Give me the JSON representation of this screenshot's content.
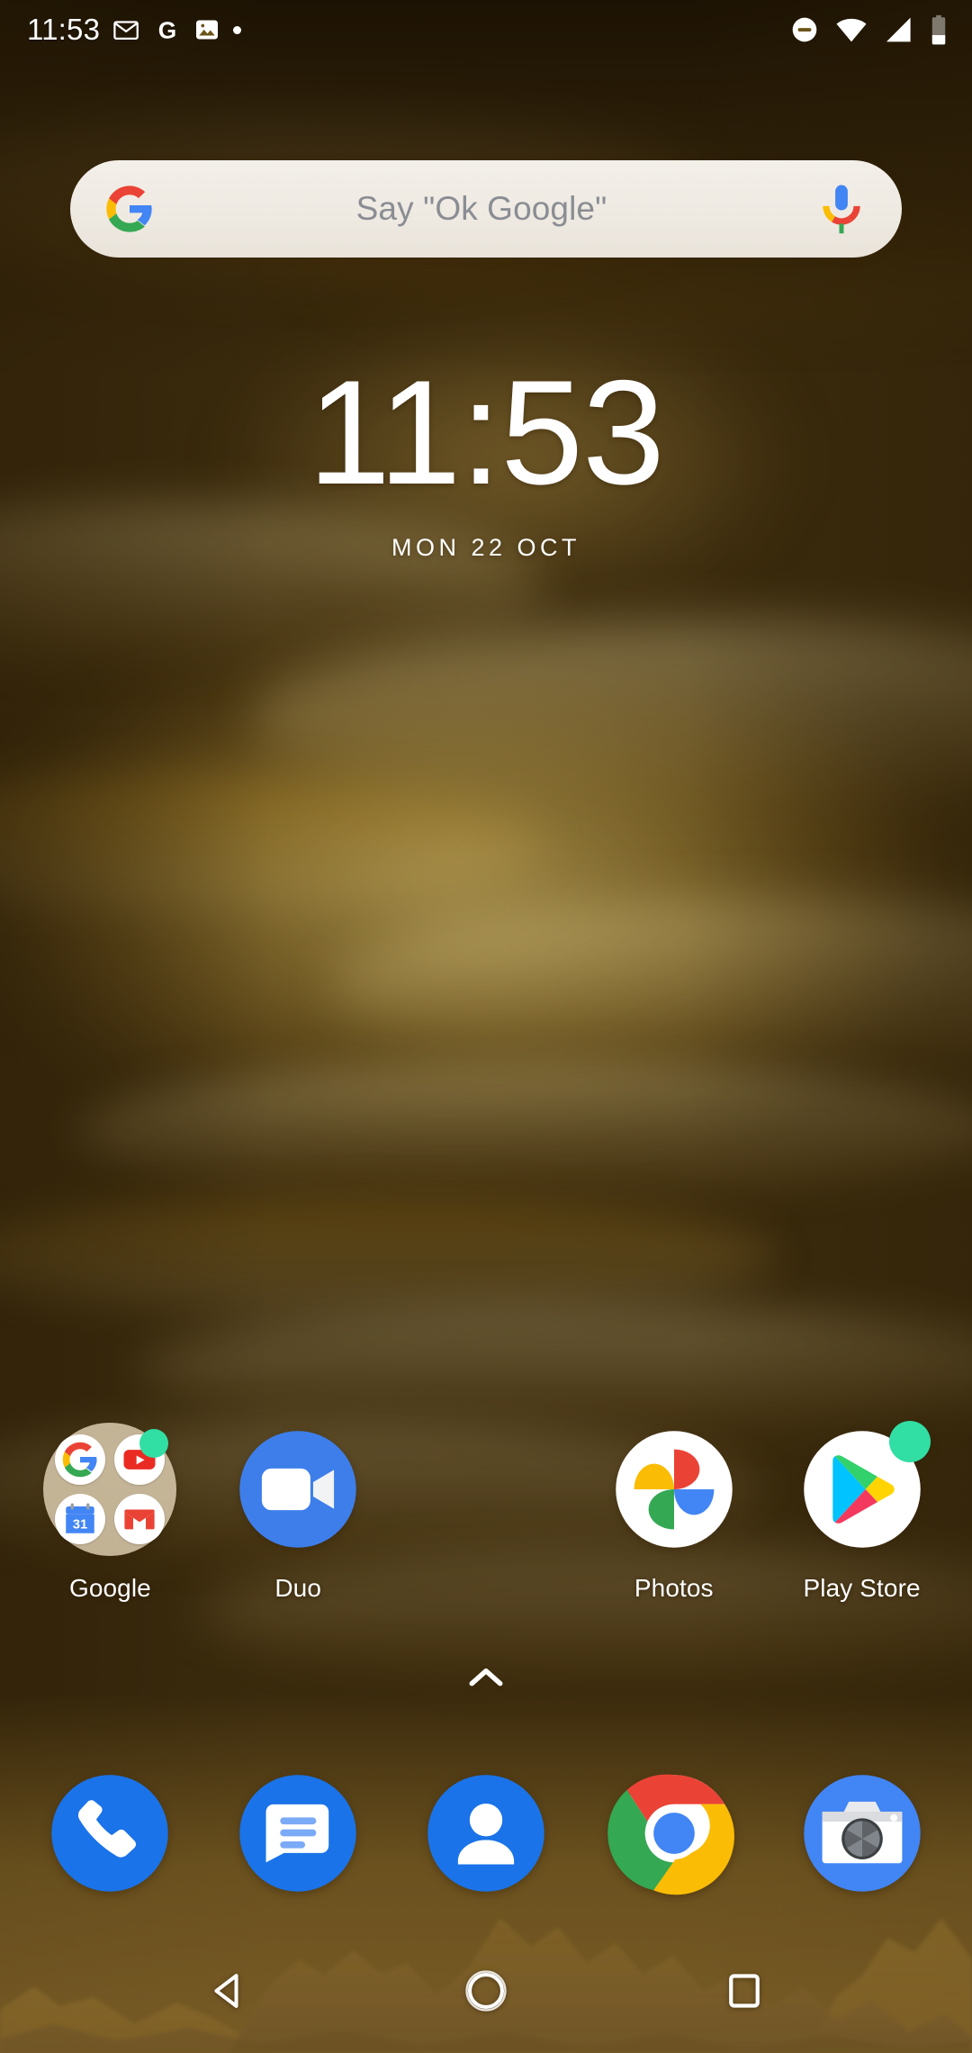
{
  "status_bar": {
    "time": "11:53",
    "left_icons": [
      {
        "name": "gmail-icon",
        "label": "Gmail"
      },
      {
        "name": "google-icon",
        "label": "G"
      },
      {
        "name": "photos-notification-icon",
        "label": "Photos"
      },
      {
        "name": "more-notifications-dot",
        "label": "•"
      }
    ],
    "right_icons": [
      {
        "name": "do-not-disturb-icon",
        "label": "Do Not Disturb"
      },
      {
        "name": "wifi-icon",
        "label": "Wi-Fi"
      },
      {
        "name": "cellular-signal-icon",
        "label": "Signal"
      },
      {
        "name": "battery-icon",
        "label": "Battery"
      }
    ]
  },
  "search": {
    "placeholder": "Say \"Ok Google\"",
    "google_logo": "google-g-logo",
    "mic_icon": "microphone-icon"
  },
  "clock_widget": {
    "time": "11:53",
    "date": "MON 22 OCT"
  },
  "app_grid": [
    {
      "name": "google-folder",
      "label": "Google",
      "type": "folder",
      "contents": [
        "Google",
        "YouTube",
        "Calendar",
        "Gmail"
      ],
      "calendar_day": "31",
      "badge": true
    },
    {
      "name": "duo",
      "label": "Duo",
      "type": "app",
      "badge": false
    },
    {
      "name": "empty-slot",
      "label": "",
      "type": "empty",
      "badge": false
    },
    {
      "name": "photos",
      "label": "Photos",
      "type": "app",
      "badge": false
    },
    {
      "name": "play-store",
      "label": "Play Store",
      "type": "app",
      "badge": true
    }
  ],
  "drawer_handle": {
    "icon": "chevron-up-icon"
  },
  "dock": [
    {
      "name": "phone",
      "label": "Phone"
    },
    {
      "name": "messages",
      "label": "Messages"
    },
    {
      "name": "contacts",
      "label": "Contacts"
    },
    {
      "name": "chrome",
      "label": "Chrome"
    },
    {
      "name": "camera",
      "label": "Camera"
    }
  ],
  "navigation_bar": [
    {
      "name": "back-button",
      "label": "Back"
    },
    {
      "name": "home-button",
      "label": "Home"
    },
    {
      "name": "recents-button",
      "label": "Recents"
    }
  ],
  "colors": {
    "wallpaper_top": "#2e2008",
    "wallpaper_mid": "#d4a71d",
    "wallpaper_bottom": "#a17b34",
    "search_pill": "#efeae2",
    "search_text": "#8a8d93",
    "badge_green": "#31dea4",
    "google_blue": "#3d7eea",
    "google_red": "#ea4335",
    "google_yellow": "#fbbc05",
    "google_green": "#34a853",
    "status_text": "#ffffff"
  }
}
